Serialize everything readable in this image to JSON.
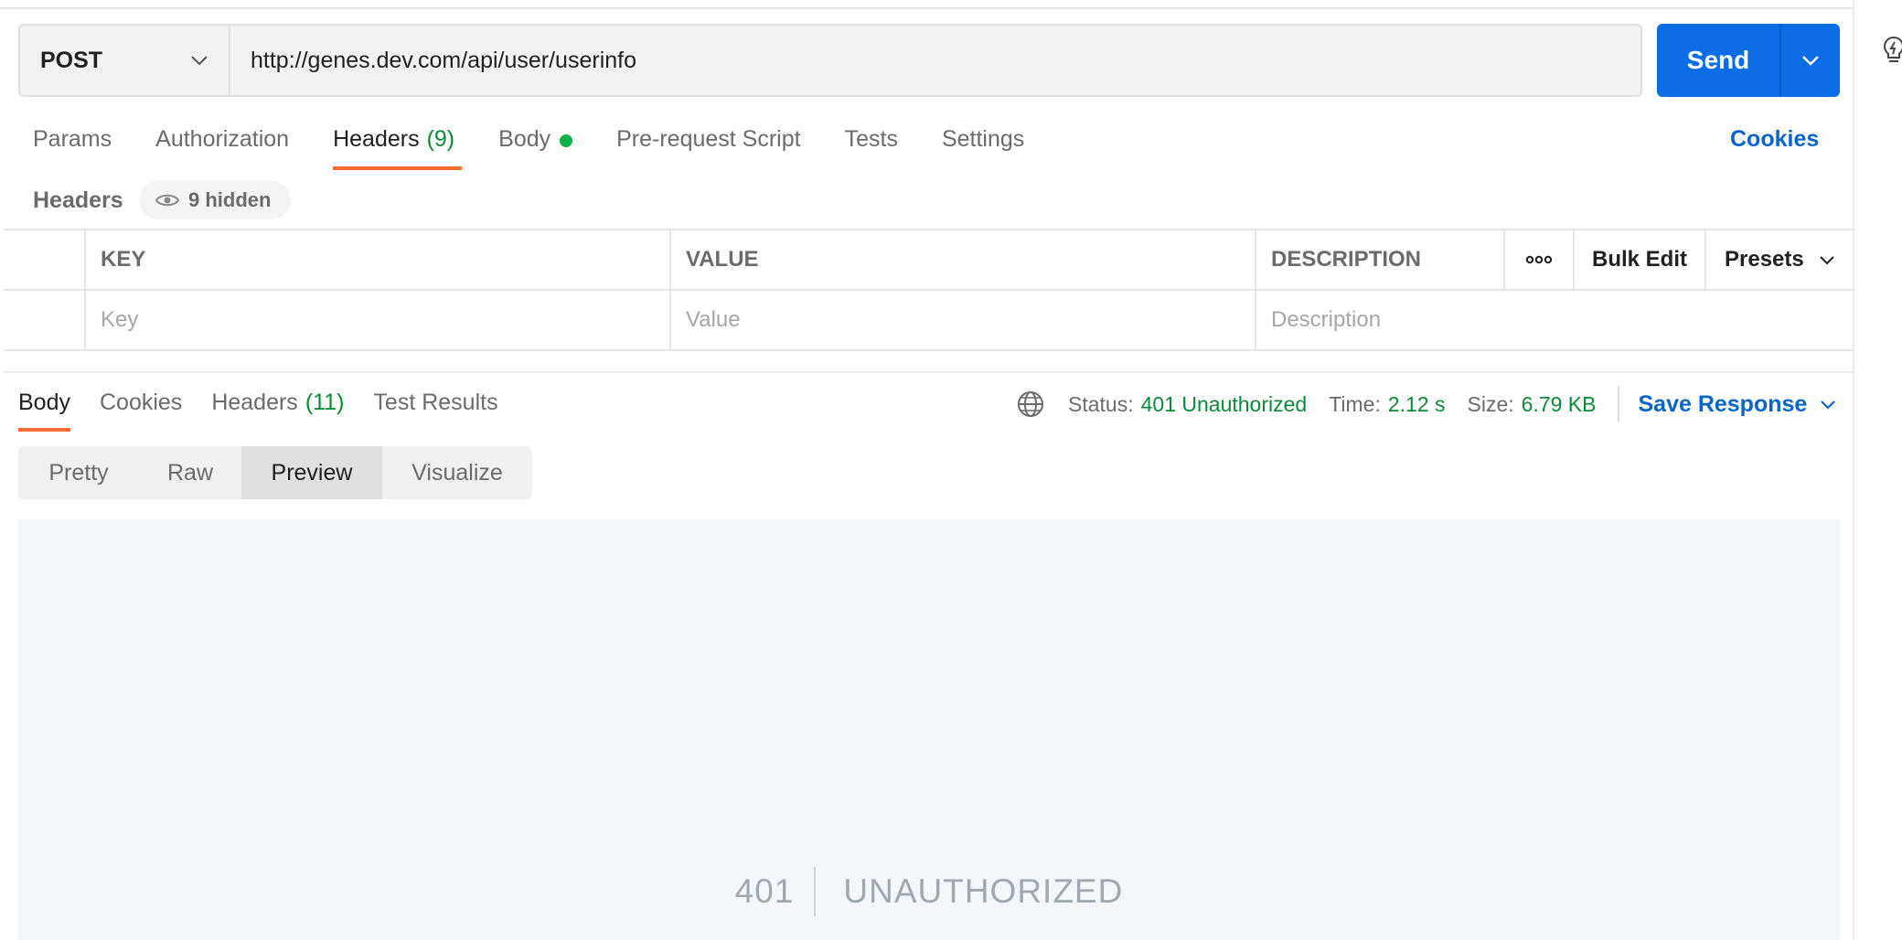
{
  "request": {
    "method": "POST",
    "url": "http://genes.dev.com/api/user/userinfo",
    "send_label": "Send"
  },
  "request_tabs": [
    {
      "label": "Params"
    },
    {
      "label": "Authorization"
    },
    {
      "label": "Headers",
      "count": "(9)",
      "active": true
    },
    {
      "label": "Body",
      "has_indicator": true
    },
    {
      "label": "Pre-request Script"
    },
    {
      "label": "Tests"
    },
    {
      "label": "Settings"
    }
  ],
  "cookies_link": "Cookies",
  "headers_section": {
    "label": "Headers",
    "hidden_label": "9 hidden"
  },
  "headers_table": {
    "columns": {
      "key": "KEY",
      "value": "VALUE",
      "description": "DESCRIPTION"
    },
    "bulk_edit": "Bulk Edit",
    "presets": "Presets",
    "placeholders": {
      "key": "Key",
      "value": "Value",
      "description": "Description"
    }
  },
  "response_tabs": [
    {
      "label": "Body",
      "active": true
    },
    {
      "label": "Cookies"
    },
    {
      "label": "Headers",
      "count": "(11)"
    },
    {
      "label": "Test Results"
    }
  ],
  "response_meta": {
    "status_label": "Status:",
    "status_value": "401 Unauthorized",
    "time_label": "Time:",
    "time_value": "2.12 s",
    "size_label": "Size:",
    "size_value": "6.79 KB",
    "save_label": "Save Response"
  },
  "view_modes": [
    {
      "label": "Pretty"
    },
    {
      "label": "Raw"
    },
    {
      "label": "Preview",
      "active": true
    },
    {
      "label": "Visualize"
    }
  ],
  "preview": {
    "code": "401",
    "message": "UNAUTHORIZED"
  },
  "colors": {
    "accent_orange": "#ff6c37",
    "send_blue": "#0c6ee6",
    "link_blue": "#0b65c8",
    "status_green": "#0b8a3a"
  }
}
